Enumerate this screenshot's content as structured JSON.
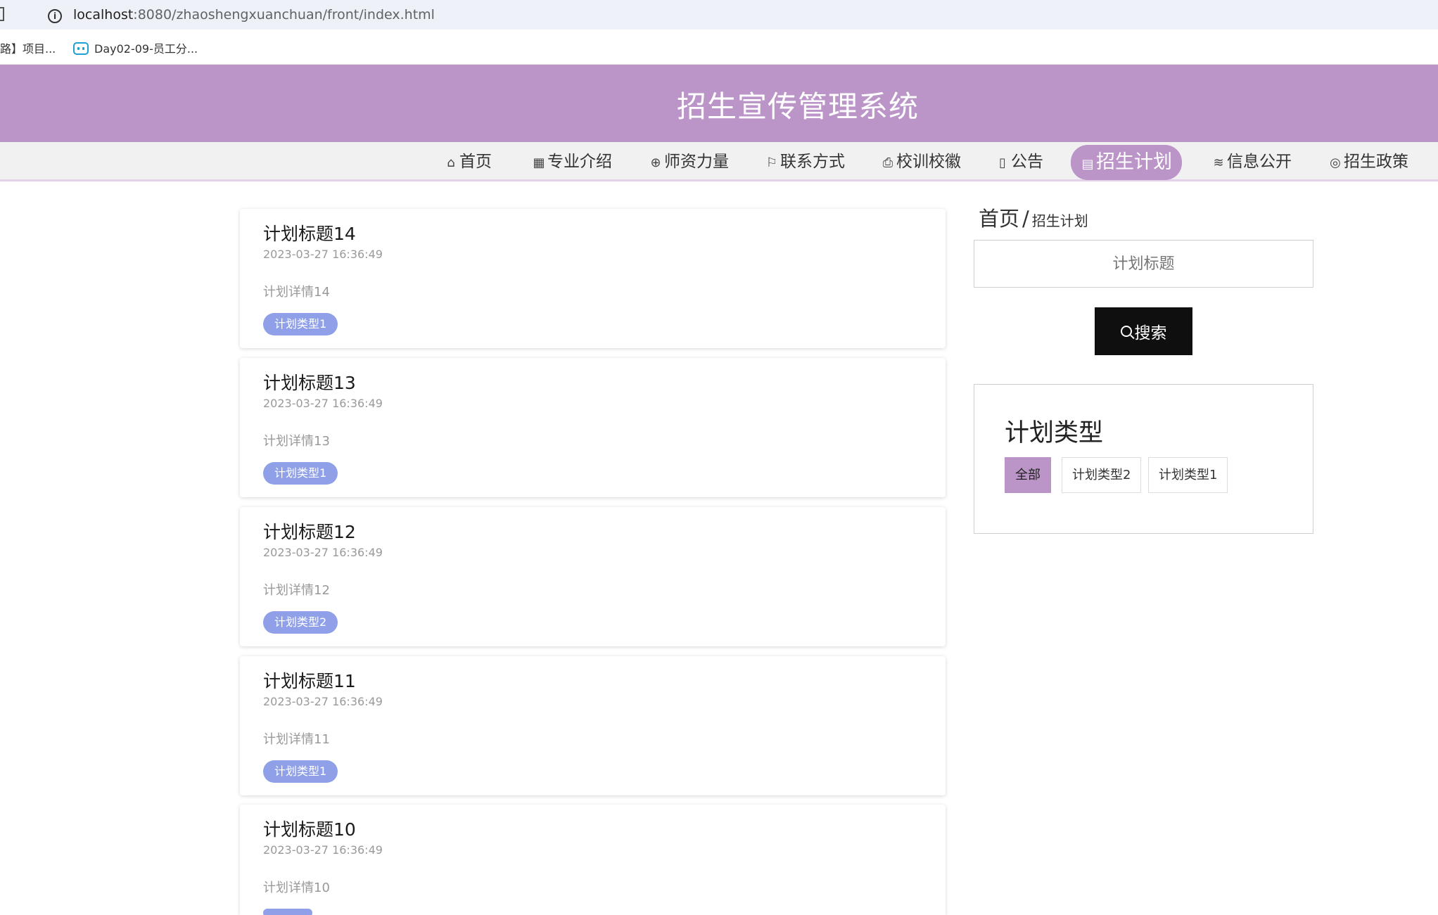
{
  "browser": {
    "url_host": "localhost",
    "url_path": ":8080/zhaoshengxuanchuan/front/index.html",
    "bookmarks": [
      {
        "label": "路】项目..."
      },
      {
        "label": "Day02-09-员工分..."
      }
    ]
  },
  "header": {
    "title": "招生宣传管理系统",
    "accent_color": "#bb95c8"
  },
  "nav": {
    "items": [
      {
        "label": "首页",
        "icon": "home-icon",
        "glyph": "⌂"
      },
      {
        "label": "专业介绍",
        "icon": "apps-icon",
        "glyph": "▦"
      },
      {
        "label": "师资力量",
        "icon": "globe-icon",
        "glyph": "⊕"
      },
      {
        "label": "联系方式",
        "icon": "flag-icon",
        "glyph": "⚐"
      },
      {
        "label": "校训校徽",
        "icon": "printer-icon",
        "glyph": "⎙"
      },
      {
        "label": "公告",
        "icon": "columns-icon",
        "glyph": "▯"
      },
      {
        "label": "招生计划",
        "icon": "calendar-icon",
        "glyph": "▤",
        "active": true
      },
      {
        "label": "信息公开",
        "icon": "layers-icon",
        "glyph": "≋"
      },
      {
        "label": "招生政策",
        "icon": "palette-icon",
        "glyph": "◎"
      }
    ]
  },
  "plans": [
    {
      "title": "计划标题14",
      "time": "2023-03-27 16:36:49",
      "detail": "计划详情14",
      "type": "计划类型1"
    },
    {
      "title": "计划标题13",
      "time": "2023-03-27 16:36:49",
      "detail": "计划详情13",
      "type": "计划类型1"
    },
    {
      "title": "计划标题12",
      "time": "2023-03-27 16:36:49",
      "detail": "计划详情12",
      "type": "计划类型2"
    },
    {
      "title": "计划标题11",
      "time": "2023-03-27 16:36:49",
      "detail": "计划详情11",
      "type": "计划类型1"
    },
    {
      "title": "计划标题10",
      "time": "2023-03-27 16:36:49",
      "detail": "计划详情10",
      "type": ""
    }
  ],
  "sidebar": {
    "breadcrumb_home": "首页",
    "breadcrumb_sep": "/",
    "breadcrumb_current": "招生计划",
    "search_placeholder": "计划标题",
    "search_label": "搜索",
    "type_title": "计划类型",
    "types": [
      {
        "label": "全部",
        "active": true
      },
      {
        "label": "计划类型2"
      },
      {
        "label": "计划类型1"
      }
    ]
  }
}
